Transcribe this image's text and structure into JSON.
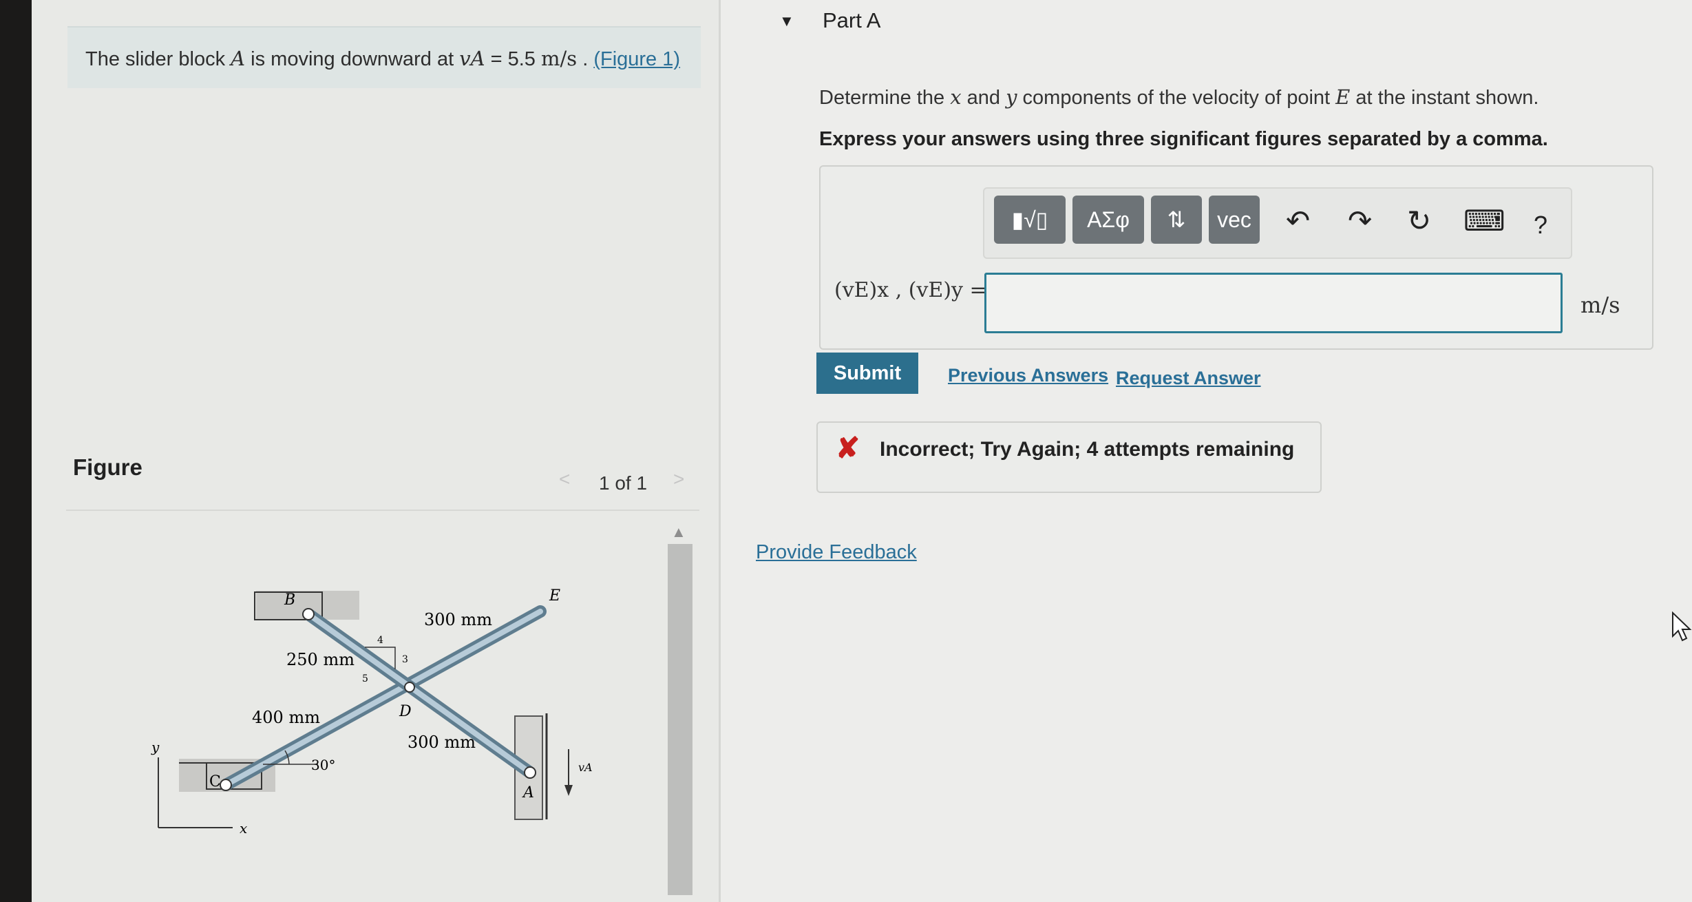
{
  "problem": {
    "text_before": "The slider block",
    "var_A": "A",
    "text_mid": "is moving downward at",
    "velocity_symbol": "vA",
    "equals": "= 5.5",
    "unit": "m/s",
    "period": ".",
    "figure_link": "(Figure 1)"
  },
  "figure": {
    "label": "Figure",
    "prev_arrow": "<",
    "next_arrow": ">",
    "count": "1 of 1",
    "scroll_up": "▲",
    "labels": {
      "B": "B",
      "C": "C",
      "D": "D",
      "E": "E",
      "A": "A",
      "x": "x",
      "y": "y",
      "vA": "vA",
      "len_300_top": "300 mm",
      "len_250": "250 mm",
      "len_400": "400 mm",
      "len_300_bottom": "300 mm",
      "angle": "30°",
      "slope_4": "4",
      "slope_3": "3",
      "slope_5": "5"
    }
  },
  "part": {
    "caret": "▼",
    "title": "Part A",
    "question_pre": "Determine the",
    "x_var": "x",
    "and": "and",
    "y_var": "y",
    "question_mid": "components of the velocity of point",
    "point_E": "E",
    "question_post": "at the instant shown.",
    "instruction": "Express your answers using three significant figures separated by a comma."
  },
  "toolbar": {
    "templates_label": "▮√▯",
    "greek_label": "ΑΣφ",
    "arrows_label": "⇅",
    "vec_label": "vec",
    "undo_icon": "↶",
    "redo_icon": "↷",
    "reset_icon": "↻",
    "keyboard_icon": "⌨",
    "help_label": "?"
  },
  "answer": {
    "variable_label": "(vE)x , (vE)y =",
    "value": "",
    "unit": "m/s"
  },
  "actions": {
    "submit": "Submit",
    "previous_answers": "Previous Answers",
    "request_answer": "Request Answer"
  },
  "feedback": {
    "icon": "✘",
    "message": "Incorrect; Try Again; 4 attempts remaining"
  },
  "provide_feedback": "Provide Feedback",
  "colors": {
    "accent": "#2c6f8d",
    "link": "#2a6f97",
    "error": "#c8201e",
    "toolbar_button": "#6d7377"
  }
}
